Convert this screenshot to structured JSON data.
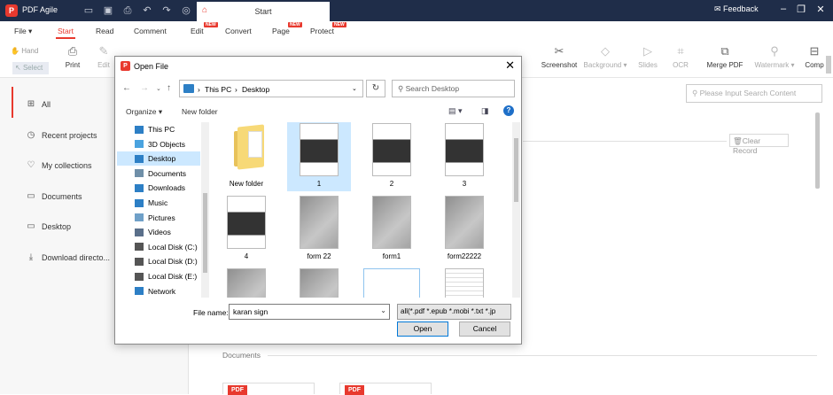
{
  "app": {
    "logo": "P",
    "name": "PDF Agile",
    "tab_title": "Start",
    "feedback": "Feedback"
  },
  "menu": {
    "items": [
      {
        "label": "File ▾",
        "active": false
      },
      {
        "label": "Start",
        "active": true
      },
      {
        "label": "Read",
        "active": false
      },
      {
        "label": "Comment",
        "active": false
      },
      {
        "label": "Edit",
        "active": false,
        "badge": "NEW"
      },
      {
        "label": "Convert",
        "active": false
      },
      {
        "label": "Page",
        "active": false,
        "badge": "NEW"
      },
      {
        "label": "Protect",
        "active": false,
        "badge": "NEW"
      }
    ]
  },
  "toolbar": {
    "hand": "Hand",
    "select": "Select",
    "print": "Print",
    "edit": "Edit",
    "screenshot": "Screenshot",
    "background": "Background ▾",
    "slides": "Slides",
    "ocr": "OCR",
    "merge": "Merge PDF",
    "watermark": "Watermark ▾",
    "comp": "Comp"
  },
  "sidebar": {
    "items": [
      {
        "label": "All",
        "icon": "grid-icon"
      },
      {
        "label": "Recent projects",
        "icon": "clock-icon"
      },
      {
        "label": "My collections",
        "icon": "heart-icon"
      },
      {
        "label": "Documents",
        "icon": "document-icon"
      },
      {
        "label": "Desktop",
        "icon": "monitor-icon"
      },
      {
        "label": "Download directo...",
        "icon": "download-icon"
      }
    ]
  },
  "main": {
    "search_placeholder": "Please Input Search Content",
    "clear_record": "Clear Record",
    "documents_label": "Documents",
    "pdf_badge": "PDF"
  },
  "dialog": {
    "title": "Open File",
    "path": [
      "This PC",
      "Desktop"
    ],
    "search_placeholder": "Search Desktop",
    "organize": "Organize ▾",
    "new_folder": "New folder",
    "tree": [
      {
        "label": "This PC",
        "color": "#2d7fc5"
      },
      {
        "label": "3D Objects",
        "color": "#4aa3df"
      },
      {
        "label": "Desktop",
        "color": "#2d7fc5",
        "selected": true
      },
      {
        "label": "Documents",
        "color": "#6f8fa8"
      },
      {
        "label": "Downloads",
        "color": "#2d7fc5"
      },
      {
        "label": "Music",
        "color": "#2d7fc5"
      },
      {
        "label": "Pictures",
        "color": "#6fa0c8"
      },
      {
        "label": "Videos",
        "color": "#5a6f8a"
      },
      {
        "label": "Local Disk (C:)",
        "color": "#555"
      },
      {
        "label": "Local Disk (D:)",
        "color": "#555"
      },
      {
        "label": "Local Disk (E:)",
        "color": "#555"
      },
      {
        "label": "Network",
        "color": "#2d7fc5"
      }
    ],
    "files": [
      {
        "label": "New folder",
        "kind": "folder"
      },
      {
        "label": "1",
        "kind": "doc",
        "selected": true
      },
      {
        "label": "2",
        "kind": "doc"
      },
      {
        "label": "3",
        "kind": "doc"
      },
      {
        "label": "4",
        "kind": "doc"
      },
      {
        "label": "form 22",
        "kind": "scan"
      },
      {
        "label": "form1",
        "kind": "scan"
      },
      {
        "label": "form22222",
        "kind": "scan"
      },
      {
        "label": "",
        "kind": "scan"
      },
      {
        "label": "",
        "kind": "scan"
      },
      {
        "label": "",
        "kind": "blank"
      },
      {
        "label": "",
        "kind": "page"
      }
    ],
    "file_name_label": "File name:",
    "file_name_value": "karan sign",
    "file_type": "all(*.pdf *.epub *.mobi *.txt *.jp",
    "open": "Open",
    "cancel": "Cancel"
  },
  "colors": {
    "accent": "#e8392e",
    "titlebar": "#1f2d49",
    "selection": "#cce8ff"
  }
}
